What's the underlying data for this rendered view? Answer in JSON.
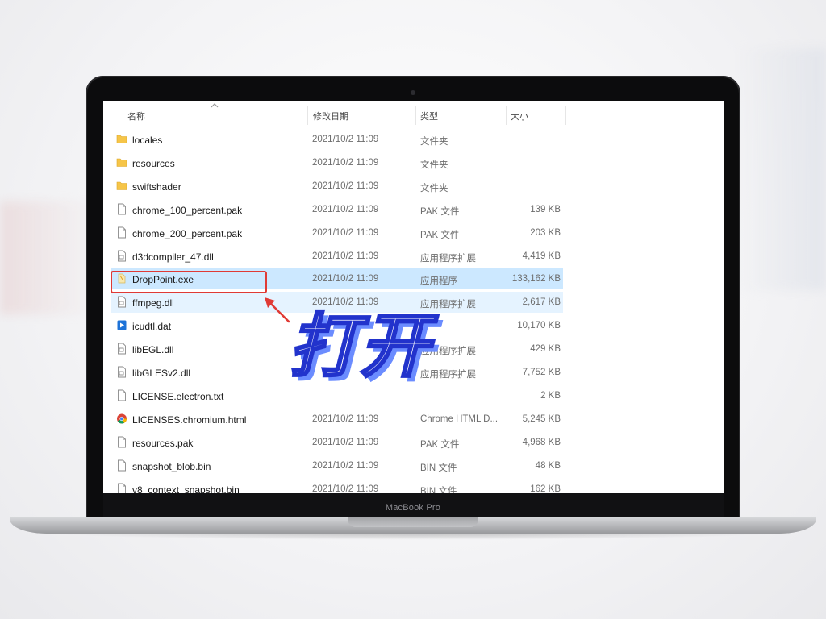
{
  "device": {
    "brand": "MacBook Pro"
  },
  "explorer": {
    "columns": {
      "name": "名称",
      "date": "修改日期",
      "type": "类型",
      "size": "大小"
    },
    "files": [
      {
        "name": "locales",
        "date": "2021/10/2 11:09",
        "type": "文件夹",
        "size": "",
        "icon": "folder-icon"
      },
      {
        "name": "resources",
        "date": "2021/10/2 11:09",
        "type": "文件夹",
        "size": "",
        "icon": "folder-icon"
      },
      {
        "name": "swiftshader",
        "date": "2021/10/2 11:09",
        "type": "文件夹",
        "size": "",
        "icon": "folder-icon"
      },
      {
        "name": "chrome_100_percent.pak",
        "date": "2021/10/2 11:09",
        "type": "PAK 文件",
        "size": "139 KB",
        "icon": "file-icon"
      },
      {
        "name": "chrome_200_percent.pak",
        "date": "2021/10/2 11:09",
        "type": "PAK 文件",
        "size": "203 KB",
        "icon": "file-icon"
      },
      {
        "name": "d3dcompiler_47.dll",
        "date": "2021/10/2 11:09",
        "type": "应用程序扩展",
        "size": "4,419 KB",
        "icon": "dll-icon"
      },
      {
        "name": "DropPoint.exe",
        "date": "2021/10/2 11:09",
        "type": "应用程序",
        "size": "133,162 KB",
        "icon": "exe-icon"
      },
      {
        "name": "ffmpeg.dll",
        "date": "2021/10/2 11:09",
        "type": "应用程序扩展",
        "size": "2,617 KB",
        "icon": "dll-icon"
      },
      {
        "name": "icudtl.dat",
        "date": "",
        "type": "",
        "size": "10,170 KB",
        "icon": "media-file-icon"
      },
      {
        "name": "libEGL.dll",
        "date": "",
        "type": "应用程序扩展",
        "size": "429 KB",
        "icon": "dll-icon"
      },
      {
        "name": "libGLESv2.dll",
        "date": "",
        "type": "应用程序扩展",
        "size": "7,752 KB",
        "icon": "dll-icon"
      },
      {
        "name": "LICENSE.electron.txt",
        "date": "",
        "type": "",
        "size": "2 KB",
        "icon": "file-icon"
      },
      {
        "name": "LICENSES.chromium.html",
        "date": "2021/10/2 11:09",
        "type": "Chrome HTML D...",
        "size": "5,245 KB",
        "icon": "chrome-icon"
      },
      {
        "name": "resources.pak",
        "date": "2021/10/2 11:09",
        "type": "PAK 文件",
        "size": "4,968 KB",
        "icon": "file-icon"
      },
      {
        "name": "snapshot_blob.bin",
        "date": "2021/10/2 11:09",
        "type": "BIN 文件",
        "size": "48 KB",
        "icon": "file-icon"
      },
      {
        "name": "v8_context_snapshot.bin",
        "date": "2021/10/2 11:09",
        "type": "BIN 文件",
        "size": "162 KB",
        "icon": "file-icon"
      }
    ],
    "selected_index": 6,
    "hover_index": 7
  },
  "overlay": {
    "text": "打开"
  },
  "colors": {
    "selection": "#cce8ff",
    "hover": "#e5f3ff",
    "highlight_box": "#e03a35",
    "overlay_stroke": "#2233cc",
    "overlay_shadow": "#6b8cff"
  }
}
